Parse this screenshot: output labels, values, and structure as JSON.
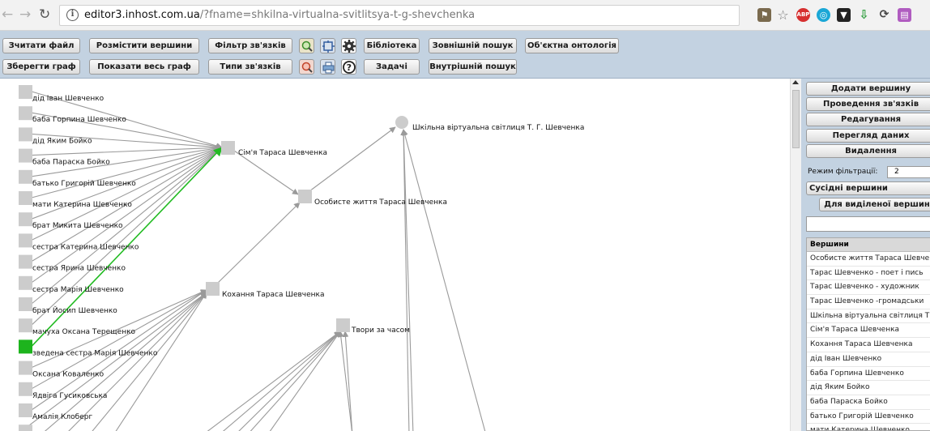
{
  "browser": {
    "url_host": "editor3.inhost.com.ua",
    "url_path": "/?fname=shkilna-virtualna-svitlitsya-t-g-shevchenka"
  },
  "toolbar": {
    "row1": [
      "Зчитати файл",
      "Розмістити вершини",
      "Фільтр зв'язків",
      "Бібліотека",
      "Зовнішній пошук",
      "Об'єктна онтологія"
    ],
    "row2": [
      "Зберегти граф",
      "Показати весь граф",
      "Типи зв'язків",
      "Задачі",
      "Внутрішній пошук"
    ]
  },
  "panel": {
    "buttons": [
      "Додати вершину",
      "Проведення зв'язків",
      "Редагування",
      "Перегляд даних",
      "Видалення"
    ],
    "filter_label": "Режим фільтрації:",
    "filter_value": "2",
    "neighbors_label": "Сусідні вершини",
    "selected_button": "Для виділеної вершини",
    "list_header": "Вершини",
    "list_items": [
      "Особисте життя Тараса Шевче",
      "Тарас Шевченко - поет і пись",
      "Тарас Шевченко - художник",
      "Тарас Шевченко -громадськи",
      "Шкільна віртуальна світлиця Т",
      "Сім'я Тараса Шевченка",
      "Кохання Тараса Шевченка",
      "дід Іван Шевченко",
      "баба Горпина Шевченко",
      "дід Яким Бойко",
      "баба Параска Бойко",
      "батько Григорій Шевченко",
      "мати Катерина Шевченко"
    ]
  },
  "graph": {
    "left_nodes": [
      "дід Іван Шевченко",
      "баба Горпина Шевченко",
      "дід Яким Бойко",
      "баба Параска Бойко",
      "батько Григорій Шевченко",
      "мати Катерина Шевченко",
      "брат Микита Шевченко",
      "сестра Катерина Шевченко",
      "сестра Ярина Шевченко",
      "сестра Марія Шевченко",
      "брат Йосип Шевченко",
      "мачуха Оксана Терещенко",
      "зведена сестра Марія Шевченко",
      "Оксана Коваленко",
      "Ядвіга Гусиковська",
      "Амалія Клоберг"
    ],
    "hubs": {
      "family": "Сім'я Тараса Шевченка",
      "personal": "Особисте життя Тараса Шевченка",
      "root": "Шкільна віртуальна світлиця Т. Г. Шевченка",
      "love": "Кохання Тараса Шевченка",
      "works": "Твори за часом"
    },
    "selected_node": "зведена сестра Марія Шевченко",
    "colors": {
      "node": "#cccccc",
      "edge": "#9a9a9a",
      "selected": "#1db41d",
      "selected_edge": "#22bb22"
    }
  }
}
